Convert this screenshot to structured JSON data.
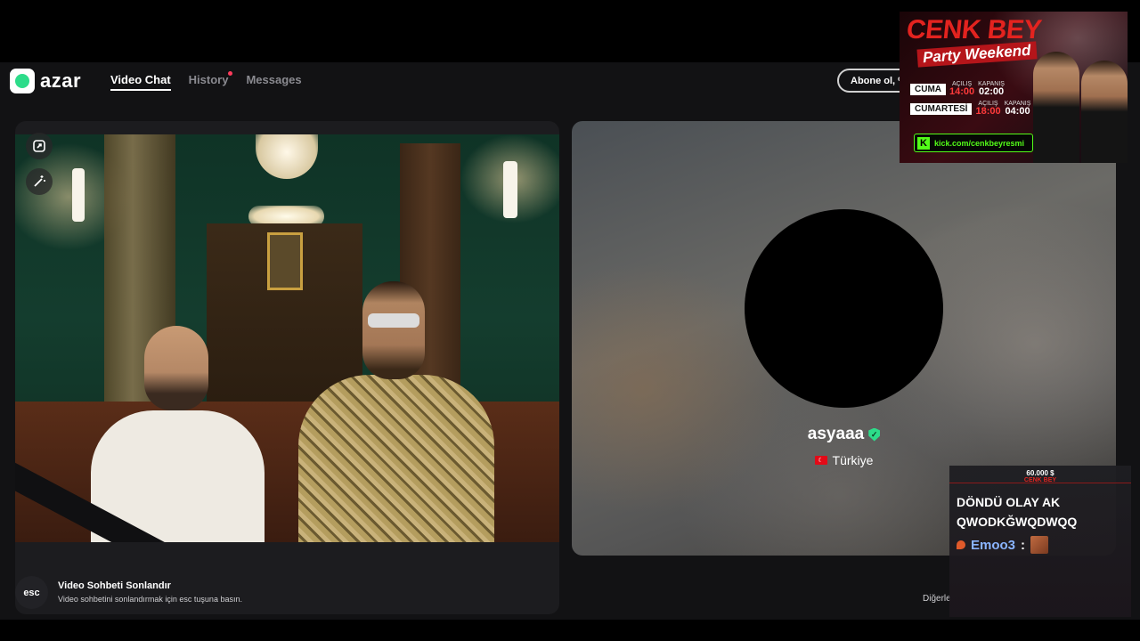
{
  "app": {
    "logo_text": "azar",
    "nav": [
      {
        "label": "Video Chat",
        "active": true
      },
      {
        "label": "History",
        "active": false,
        "has_notification": true
      },
      {
        "label": "Messages",
        "active": false
      }
    ],
    "subscribe_label": "Abone ol, %",
    "accent_color": "#2ddc8a"
  },
  "left_video": {
    "expand_icon": "expand-icon",
    "effects_icon": "magic-wand-icon"
  },
  "partner": {
    "username": "asyaaa",
    "verified_icon": "shield-check-icon",
    "country": "Türkiye",
    "flag_icon": "turkey-flag-icon"
  },
  "footer": {
    "esc_key": "esc",
    "end_title": "Video Sohbeti Sonlandır",
    "end_description": "Video sohbetini sonlandırmak için esc tuşuna basın.",
    "others_text": "Diğerle"
  },
  "overlay_ad": {
    "title": "CENK BEY",
    "subtitle": "Party Weekend",
    "rows": [
      {
        "day": "CUMA",
        "open_label": "AÇILIŞ",
        "open_time": "14:00",
        "close_label": "KAPANIŞ",
        "close_time": "02:00"
      },
      {
        "day": "CUMARTESİ",
        "open_label": "AÇILIŞ",
        "open_time": "18:00",
        "close_label": "KAPANIŞ",
        "close_time": "04:00"
      }
    ],
    "kick_url": "kick.com/cenkbeyresmi",
    "brand_color": "#53fc18"
  },
  "donation": {
    "amount": "60.000 $",
    "streamer": "CENK BEY",
    "message": "DÖNDÜ OLAY AK QWODKĞWQDWQQ",
    "user": "Emoo3",
    "colon": ":"
  }
}
